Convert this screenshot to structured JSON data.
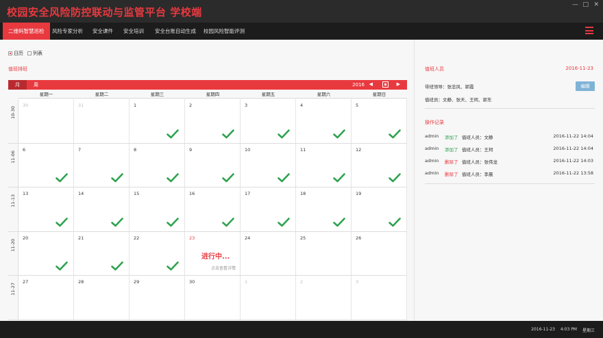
{
  "window": {
    "title": "校园安全风险防控联动与监管平台  学校端",
    "controls": [
      "—",
      "□",
      "✕"
    ]
  },
  "nav": {
    "items": [
      {
        "label": "二维码智慧巡检",
        "active": true
      },
      {
        "label": "风险专家分析",
        "active": false
      },
      {
        "label": "安全课件",
        "active": false
      },
      {
        "label": "安全培训",
        "active": false
      },
      {
        "label": "安全台账自动生成",
        "active": false
      },
      {
        "label": "校园风险智能评测",
        "active": false
      }
    ],
    "menu_icon": "hamburger-icon"
  },
  "left": {
    "view_options": [
      {
        "label": "日历",
        "checked": true
      },
      {
        "label": "列表",
        "checked": false
      }
    ],
    "section_title": "值班排班",
    "toolbar": {
      "month_label": "月",
      "week_label": "周",
      "year": "2016",
      "prev": "◀",
      "next": "▶"
    },
    "weekdays": [
      "星期一",
      "星期二",
      "星期三",
      "星期四",
      "星期五",
      "星期六",
      "星期日"
    ],
    "weeks": [
      {
        "label": "10-30",
        "days": [
          {
            "n": "30",
            "other": true,
            "check": false
          },
          {
            "n": "31",
            "other": true,
            "check": false
          },
          {
            "n": "1",
            "check": true
          },
          {
            "n": "2",
            "check": true
          },
          {
            "n": "3",
            "check": true
          },
          {
            "n": "4",
            "check": true
          },
          {
            "n": "5",
            "check": true
          }
        ]
      },
      {
        "label": "11-06",
        "days": [
          {
            "n": "6",
            "check": true
          },
          {
            "n": "7",
            "check": true
          },
          {
            "n": "8",
            "check": true
          },
          {
            "n": "9",
            "check": true
          },
          {
            "n": "10",
            "check": true
          },
          {
            "n": "11",
            "check": true
          },
          {
            "n": "12",
            "check": true
          }
        ]
      },
      {
        "label": "11-13",
        "days": [
          {
            "n": "13",
            "check": true
          },
          {
            "n": "14",
            "check": true
          },
          {
            "n": "15",
            "check": true
          },
          {
            "n": "16",
            "check": true
          },
          {
            "n": "17",
            "check": true
          },
          {
            "n": "18",
            "check": true
          },
          {
            "n": "19",
            "check": true
          }
        ]
      },
      {
        "label": "11-20",
        "days": [
          {
            "n": "20",
            "check": true
          },
          {
            "n": "21",
            "check": true
          },
          {
            "n": "22",
            "check": true
          },
          {
            "n": "23",
            "today": true,
            "check": false,
            "status": "进行中...",
            "link": "点击查看详情"
          },
          {
            "n": "24",
            "check": false
          },
          {
            "n": "25",
            "check": false
          },
          {
            "n": "26",
            "check": false
          }
        ]
      },
      {
        "label": "11-27",
        "days": [
          {
            "n": "27",
            "check": false
          },
          {
            "n": "28",
            "check": false
          },
          {
            "n": "29",
            "check": false
          },
          {
            "n": "30",
            "check": false
          },
          {
            "n": "1",
            "other": true,
            "check": false
          },
          {
            "n": "2",
            "other": true,
            "check": false
          },
          {
            "n": "3",
            "other": true,
            "check": false
          }
        ]
      }
    ],
    "check_color": "#2ea24f"
  },
  "right": {
    "duty_title": "值班人员",
    "date": "2016-11-23",
    "leader": "带班领导：张忠风、郭霞",
    "staff": "值班员：文静、张天、王珂、郭东",
    "edit_label": "编辑",
    "log_title": "操作记录",
    "logs": [
      {
        "user": "admin",
        "action": "添加了",
        "type": "add",
        "desc": "值班人员：文静",
        "time": "2016-11-22  14:04"
      },
      {
        "user": "admin",
        "action": "添加了",
        "type": "add",
        "desc": "值班人员：王珂",
        "time": "2016-11-22  14:04"
      },
      {
        "user": "admin",
        "action": "删除了",
        "type": "del",
        "desc": "值班人员：张伟龙",
        "time": "2016-11-22  14:03"
      },
      {
        "user": "admin",
        "action": "删除了",
        "type": "del",
        "desc": "值班人员：李晨",
        "time": "2016-11-22  13:58"
      }
    ]
  },
  "status": {
    "date": "2016-11-23",
    "time": "4:03 PM",
    "weekday": "星期三"
  },
  "colors": {
    "accent": "#e8393f",
    "dark": "#1c1c1c",
    "add": "#2ea24f"
  }
}
